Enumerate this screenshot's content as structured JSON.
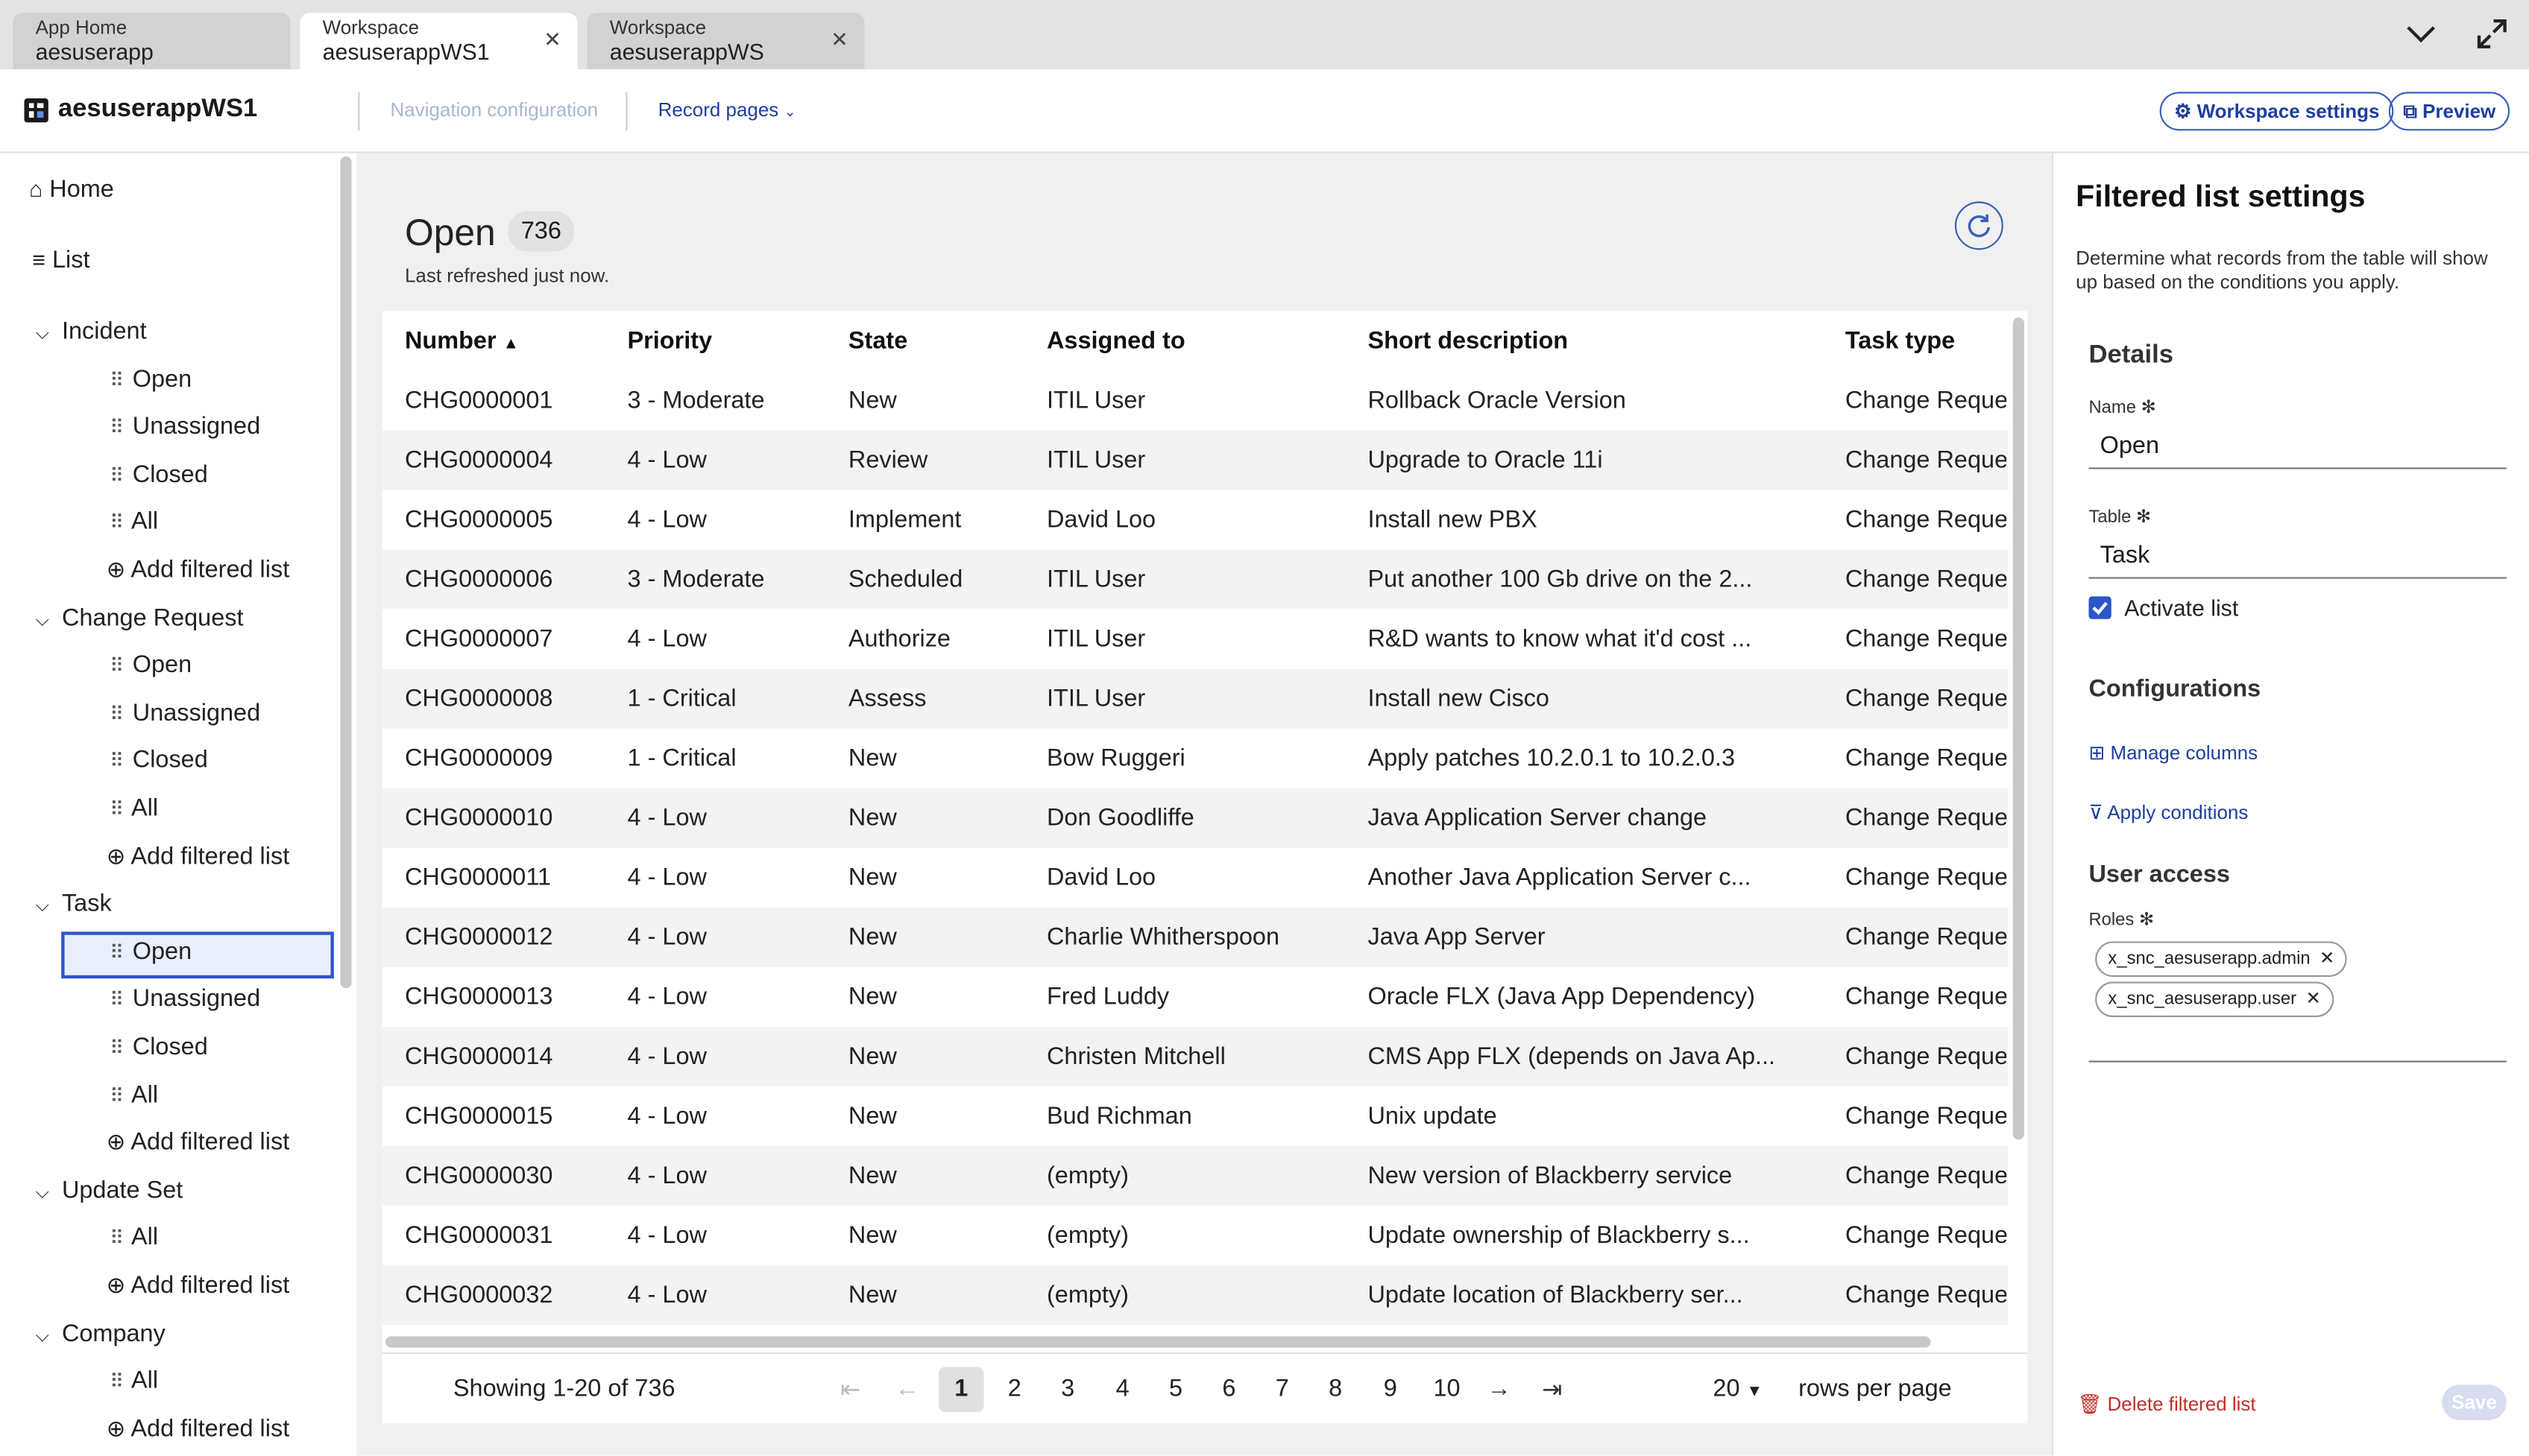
{
  "tabs": [
    {
      "title": "App Home",
      "subtitle": "aesuserapp"
    },
    {
      "title": "Workspace",
      "subtitle": "aesuserappWS1"
    },
    {
      "title": "Workspace",
      "subtitle": "aesuserappWS"
    }
  ],
  "header": {
    "app_name": "aesuserappWS1",
    "nav_config": "Navigation configuration",
    "record_pages": "Record pages",
    "workspace_settings": "Workspace settings",
    "preview": "Preview"
  },
  "sidebar": {
    "home": "Home",
    "list": "List",
    "groups": [
      {
        "label": "Incident",
        "items": [
          "Open",
          "Unassigned",
          "Closed",
          "All"
        ],
        "add": "Add filtered list"
      },
      {
        "label": "Change Request",
        "items": [
          "Open",
          "Unassigned",
          "Closed",
          "All"
        ],
        "add": "Add filtered list"
      },
      {
        "label": "Task",
        "items": [
          "Open",
          "Unassigned",
          "Closed",
          "All"
        ],
        "add": "Add filtered list"
      },
      {
        "label": "Update Set",
        "items": [
          "All"
        ],
        "add": "Add filtered list"
      },
      {
        "label": "Company",
        "items": [
          "All"
        ],
        "add": "Add filtered list"
      }
    ]
  },
  "list": {
    "title": "Open",
    "count": "736",
    "refreshed": "Last refreshed just now.",
    "columns": [
      "Number",
      "Priority",
      "State",
      "Assigned to",
      "Short description",
      "Task type"
    ],
    "rows": [
      [
        "CHG0000001",
        "3 - Moderate",
        "New",
        "ITIL User",
        "Rollback Oracle Version",
        "Change Reque"
      ],
      [
        "CHG0000004",
        "4 - Low",
        "Review",
        "ITIL User",
        "Upgrade to Oracle 11i",
        "Change Reque"
      ],
      [
        "CHG0000005",
        "4 - Low",
        "Implement",
        "David Loo",
        "Install new PBX",
        "Change Reque"
      ],
      [
        "CHG0000006",
        "3 - Moderate",
        "Scheduled",
        "ITIL User",
        "Put another 100 Gb drive on the 2...",
        "Change Reque"
      ],
      [
        "CHG0000007",
        "4 - Low",
        "Authorize",
        "ITIL User",
        "R&D wants to know what it'd cost ...",
        "Change Reque"
      ],
      [
        "CHG0000008",
        "1 - Critical",
        "Assess",
        "ITIL User",
        "Install new Cisco",
        "Change Reque"
      ],
      [
        "CHG0000009",
        "1 - Critical",
        "New",
        "Bow Ruggeri",
        "Apply patches 10.2.0.1 to 10.2.0.3",
        "Change Reque"
      ],
      [
        "CHG0000010",
        "4 - Low",
        "New",
        "Don Goodliffe",
        "Java Application Server change",
        "Change Reque"
      ],
      [
        "CHG0000011",
        "4 - Low",
        "New",
        "David Loo",
        "Another Java Application Server c...",
        "Change Reque"
      ],
      [
        "CHG0000012",
        "4 - Low",
        "New",
        "Charlie Whitherspoon",
        "Java App Server",
        "Change Reque"
      ],
      [
        "CHG0000013",
        "4 - Low",
        "New",
        "Fred Luddy",
        "Oracle FLX (Java App Dependency)",
        "Change Reque"
      ],
      [
        "CHG0000014",
        "4 - Low",
        "New",
        "Christen Mitchell",
        "CMS App FLX (depends on Java Ap...",
        "Change Reque"
      ],
      [
        "CHG0000015",
        "4 - Low",
        "New",
        "Bud Richman",
        "Unix update",
        "Change Reque"
      ],
      [
        "CHG0000030",
        "4 - Low",
        "New",
        "(empty)",
        "New version of Blackberry service",
        "Change Reque"
      ],
      [
        "CHG0000031",
        "4 - Low",
        "New",
        "(empty)",
        "Update ownership of Blackberry s...",
        "Change Reque"
      ],
      [
        "CHG0000032",
        "4 - Low",
        "New",
        "(empty)",
        "Update location of Blackberry ser...",
        "Change Reque"
      ]
    ],
    "pagination": {
      "showing": "Showing 1-20 of 736",
      "pages": [
        "1",
        "2",
        "3",
        "4",
        "5",
        "6",
        "7",
        "8",
        "9",
        "10"
      ],
      "current": "1",
      "rows_per_page": "20",
      "rows_per_page_label": "rows per page"
    }
  },
  "panel": {
    "title": "Filtered list settings",
    "description": "Determine what records from the table will show up based on the conditions you apply.",
    "details_heading": "Details",
    "name_label": "Name",
    "name_value": "Open",
    "table_label": "Table",
    "table_value": "Task",
    "activate_label": "Activate list",
    "configurations_heading": "Configurations",
    "manage_columns": "Manage columns",
    "apply_conditions": "Apply conditions",
    "user_access_heading": "User access",
    "roles_label": "Roles",
    "roles": [
      "x_snc_aesuserapp.admin",
      "x_snc_aesuserapp.user"
    ],
    "delete": "Delete filtered list",
    "save": "Save"
  },
  "colors": {
    "accent": "#1d3f9e",
    "selected": "#e8eefb"
  }
}
